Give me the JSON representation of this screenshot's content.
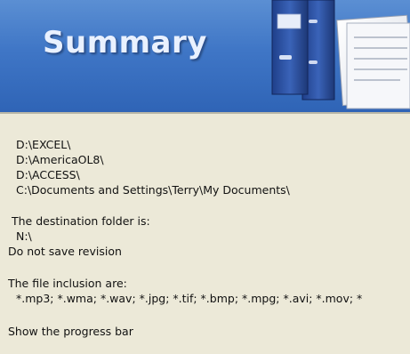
{
  "banner": {
    "title": "Summary",
    "icon": "binder-document-icon",
    "colors": {
      "gradient_top": "#5b8fd3",
      "gradient_bottom": "#2f64b6"
    }
  },
  "summary": {
    "source_folders": [
      "D:\\EXCEL\\",
      "D:\\AmericaOL8\\",
      "D:\\ACCESS\\",
      "C:\\Documents and Settings\\Terry\\My Documents\\"
    ],
    "destination_heading": "The destination folder is:",
    "destination_folder": "N:\\",
    "revision_option": "Do not save revision",
    "inclusion_heading": "The file inclusion are:",
    "file_inclusions": "*.mp3; *.wma; *.wav; *.jpg; *.tif; *.bmp; *.mpg; *.avi; *.mov; *",
    "progress_option": "Show the progress bar"
  }
}
